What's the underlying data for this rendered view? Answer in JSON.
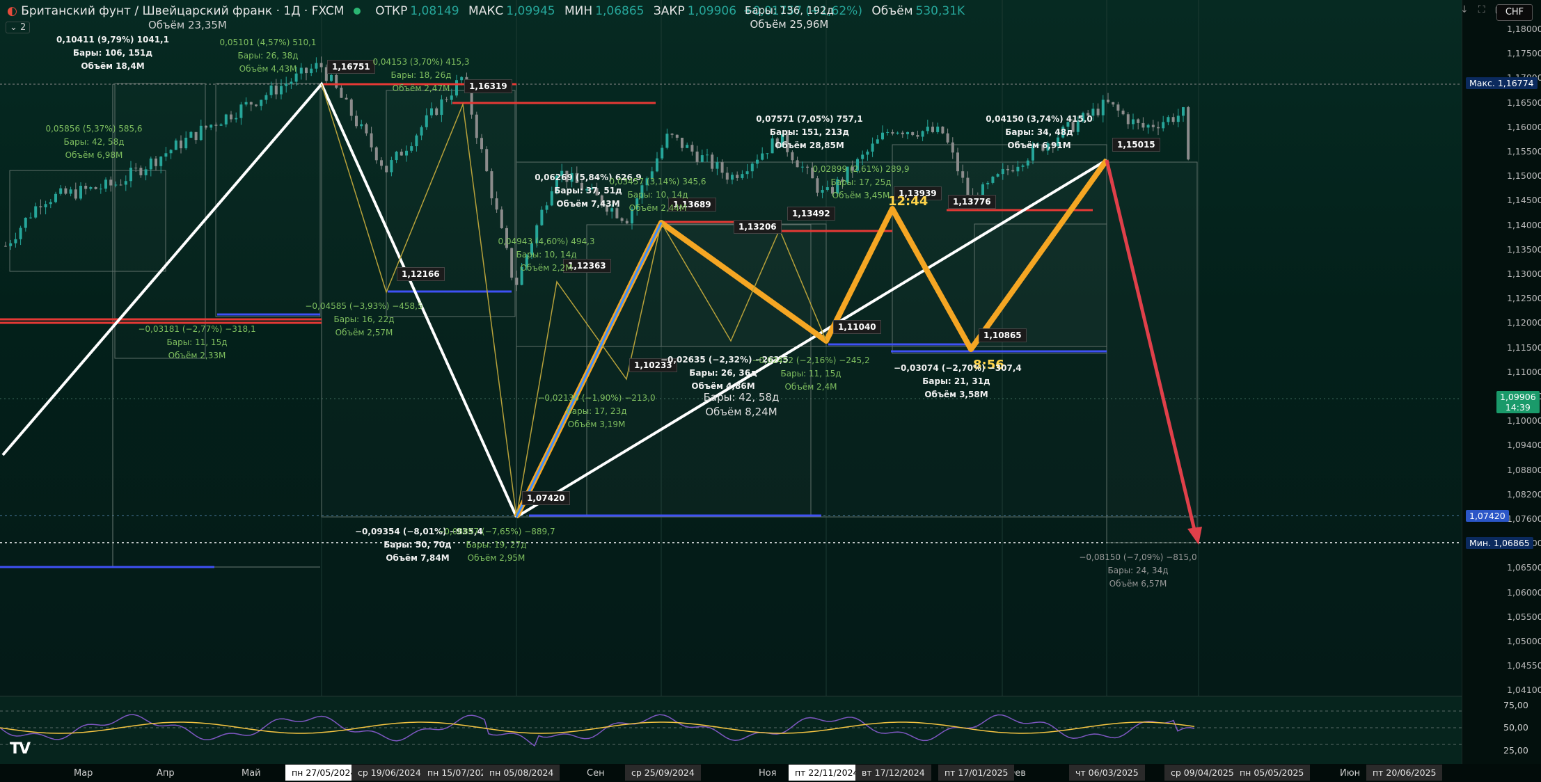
{
  "header": {
    "title": "Британский фунт / Швейцарский франк · 1Д · FXCM",
    "open_label": "ОТКР",
    "open_value": "1,08149",
    "high_label": "МАКС",
    "high_value": "1,09945",
    "low_label": "МИН",
    "low_value": "1,06865",
    "close_label": "ЗАКР",
    "close_value": "1,09906",
    "change_value": "+0,01757 (+1,62%)",
    "volume_label": "Объём",
    "volume_value": "530,31K",
    "sub_volume": "Объём 23,35M",
    "indicator_count": "2"
  },
  "center_stats": {
    "bars": "Бары: 136, 192д",
    "volume": "Объём 25,96M"
  },
  "toolbar": {
    "currency": "CHF",
    "download_icon": "download-icon",
    "fullscreen_icon": "fullscreen-icon",
    "maximize_icon": "maximize-icon"
  },
  "price_axis": {
    "ticks": [
      "1,18000",
      "1,17500",
      "1,17000",
      "1,16500",
      "1,16000",
      "1,15500",
      "1,15000",
      "1,14500",
      "1,14000",
      "1,13500",
      "1,13000",
      "1,12500",
      "1,12000",
      "1,11500",
      "1,11000",
      "1,10500",
      "1,10000",
      "1,09400",
      "1,08800",
      "1,08200",
      "1,07600",
      "1,07000",
      "1,06500",
      "1,06000",
      "1,05500",
      "1,05000",
      "1,04550",
      "1,04100"
    ],
    "max_label": "Макс.",
    "max_value": "1,16774",
    "min_label": "Мин.",
    "min_value": "1,06865",
    "current_price": "1,09906",
    "current_timer": "14:39",
    "level_price": "1,07420"
  },
  "oscillator": {
    "levels": [
      "75,00",
      "50,00",
      "25,00"
    ]
  },
  "time_axis": {
    "labels": [
      "Мар",
      "Апр",
      "Май",
      "Сен",
      "Ноя",
      "Фев",
      "Июн"
    ],
    "boxes": [
      "пн 27/05/2024",
      "ср 19/06/2024",
      "пн 15/07/2024",
      "пн 05/08/2024",
      "ср 25/09/2024",
      "пт 22/11/2024",
      "вт 17/12/2024",
      "пт 17/01/2025",
      "чт 06/03/2025",
      "ср 09/04/2025",
      "пн 05/05/2025",
      "пт 20/06/2025"
    ]
  },
  "price_tags": [
    "1,16751",
    "1,16319",
    "1,12166",
    "1,07420",
    "1,12363",
    "1,10233",
    "1,13689",
    "1,13206",
    "1,13492",
    "1,11040",
    "1,13939",
    "1,13776",
    "1,10865",
    "1,15015"
  ],
  "timers": [
    "12:44",
    "8:56"
  ],
  "annotations": {
    "a1": [
      "0,10411 (9,79%) 1041,1",
      "Бары: 106, 151д",
      "Объём 18,4M"
    ],
    "a2": [
      "0,05101 (4,57%) 510,1",
      "Бары: 26, 38д",
      "Объём 4,43M"
    ],
    "a3": [
      "0,04153 (3,70%) 415,3",
      "Бары: 18, 26д",
      "Объём 2,47M"
    ],
    "a4": [
      "0,05856 (5,37%) 585,6",
      "Бары: 42, 58д",
      "Объём 6,98M"
    ],
    "a5": [
      "−0,03181 (−2,77%) −318,1",
      "Бары: 11, 15д",
      "Объём 2,33M"
    ],
    "a6": [
      "−0,04585 (−3,93%) −458,5",
      "Бары: 16, 22д",
      "Объём 2,57M"
    ],
    "a7": [
      "0,06269 (5,84%) 626,9",
      "Бары: 37, 51д",
      "Объём 7,43M"
    ],
    "a8": [
      "0,03457 (3,14%) 345,6",
      "Бары: 10, 14д",
      "Объём 2,44M"
    ],
    "a9": [
      "0,04943 (4,60%) 494,3",
      "Бары: 10, 14д",
      "Объём 2,2M"
    ],
    "a10": [
      "−0,02130 (−1,90%) −213,0",
      "Бары: 17, 23д",
      "Объём 3,19M"
    ],
    "a11": [
      "−0,09354 (−8,01%) −935,4",
      "Бары: 50, 70д",
      "Объём 7,84M"
    ],
    "a12": [
      "−0,08897 (−7,65%) −889,7",
      "Бары: 19, 27д",
      "Объём 2,95M"
    ],
    "a13": [
      "0,07571 (7,05%) 757,1",
      "Бары: 151, 213д",
      "Объём 28,85M"
    ],
    "a14": [
      "0,02899 (2,61%) 289,9",
      "Бары: 17, 25д",
      "Объём 3,45M"
    ],
    "a15": [
      "0,04150 (3,74%) 415,0",
      "Бары: 34, 48д",
      "Объём 6,91M"
    ],
    "a16": [
      "−0,02635 (−2,32%) −263,5",
      "Бары: 26, 36д",
      "Объём 4,86M"
    ],
    "a17": [
      "Бары: 42, 58д",
      "Объём 8,24M"
    ],
    "a18": [
      "−0,02452 (−2,16%) −245,2",
      "Бары: 11, 15д",
      "Объём 2,4M"
    ],
    "a19": [
      "−0,03074 (−2,70%) −307,4",
      "Бары: 21, 31д",
      "Объём 3,58M"
    ],
    "a20": [
      "−0,08150 (−7,09%) −815,0",
      "Бары: 24, 34д",
      "Объём 6,57M"
    ]
  },
  "colors": {
    "background": "#031a14",
    "up": "#26a69a",
    "zigzag": "#f5a623",
    "down_arrow": "#e0404a",
    "trend": "#ffffff",
    "level_red": "#e53935",
    "level_blue": "#3f51f5"
  },
  "logo": "TV"
}
